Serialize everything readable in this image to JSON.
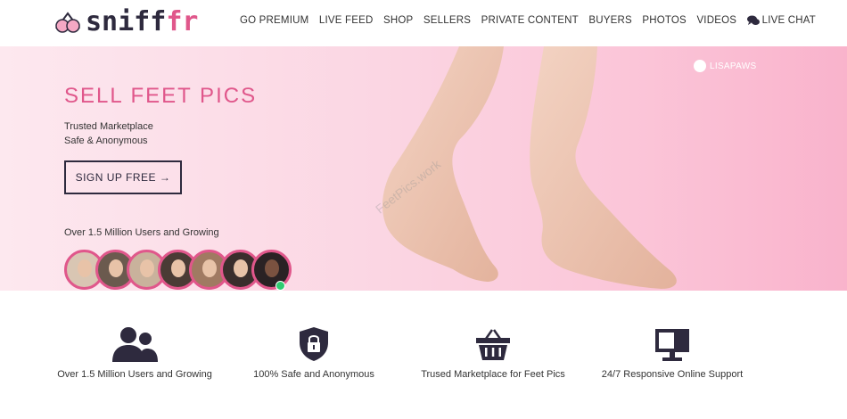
{
  "brand": {
    "prefix": "sniff",
    "accent": "fr",
    "logo_icon": "heart-logo-icon"
  },
  "nav": {
    "items": [
      "GO PREMIUM",
      "LIVE FEED",
      "SHOP",
      "SELLERS",
      "PRIVATE CONTENT",
      "BUYERS",
      "PHOTOS",
      "VIDEOS"
    ],
    "live_chat": "LIVE CHAT"
  },
  "hero": {
    "title": "SELL FEET PICS",
    "sub_line1": "Trusted Marketplace",
    "sub_line2": "Safe & Anonymous",
    "cta": "SIGN UP FREE →",
    "growing": "Over 1.5 Million Users and Growing",
    "user_tag": "LISAPAWS",
    "watermark": "FeetPics.work"
  },
  "features": [
    {
      "icon": "users-icon",
      "label": "Over 1.5 Million Users and Growing"
    },
    {
      "icon": "shield-lock-icon",
      "label": "100% Safe and Anonymous"
    },
    {
      "icon": "basket-icon",
      "label": "Trused Marketplace for Feet Pics"
    },
    {
      "icon": "monitor-support-icon",
      "label": "24/7 Responsive Online Support"
    }
  ],
  "colors": {
    "accent": "#e0578b",
    "dark": "#2e2a3e",
    "online": "#2ecc71"
  }
}
